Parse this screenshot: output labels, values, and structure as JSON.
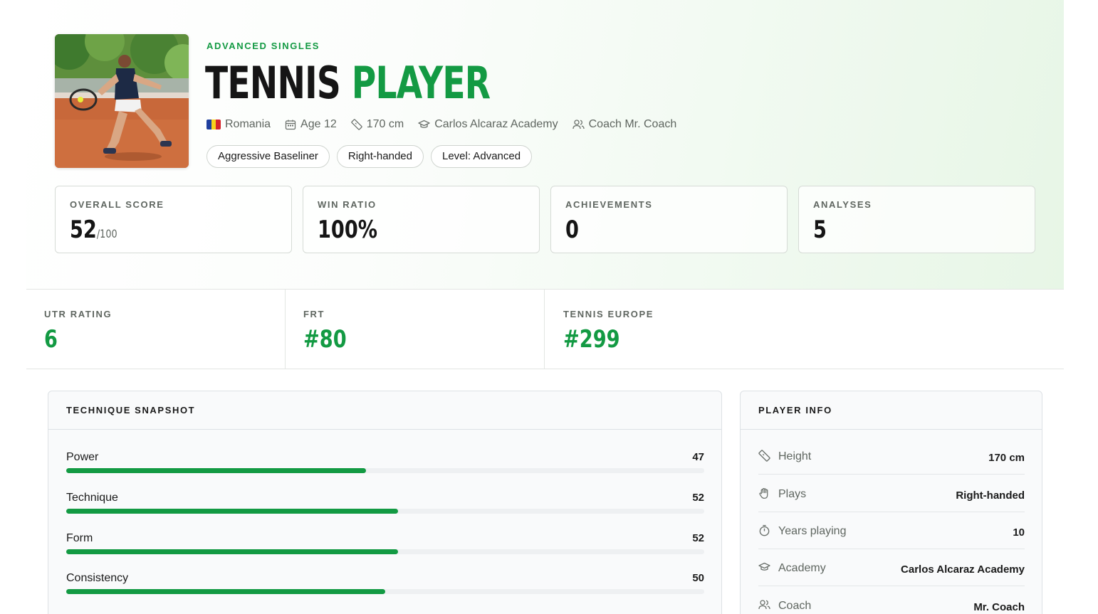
{
  "colors": {
    "accent": "#139a43",
    "text_dark": "#151515",
    "text_muted": "#5f6660",
    "track": "#eef0f2"
  },
  "hero": {
    "eyebrow": "ADVANCED SINGLES",
    "title_part1": "TENNIS",
    "title_part2": "PLAYER",
    "meta": {
      "country": "Romania",
      "age": "Age 12",
      "height": "170 cm",
      "academy": "Carlos Alcaraz Academy",
      "coach": "Coach Mr. Coach"
    },
    "chips": [
      "Aggressive Baseliner",
      "Right-handed",
      "Level: Advanced"
    ]
  },
  "stats": [
    {
      "label": "OVERALL SCORE",
      "value": "52",
      "suffix": "/100"
    },
    {
      "label": "WIN RATIO",
      "value": "100%",
      "suffix": ""
    },
    {
      "label": "ACHIEVEMENTS",
      "value": "0",
      "suffix": ""
    },
    {
      "label": "ANALYSES",
      "value": "5",
      "suffix": ""
    }
  ],
  "ratings": [
    {
      "label": "UTR RATING",
      "value": "6"
    },
    {
      "label": "FRT",
      "value": "#80"
    },
    {
      "label": "TENNIS EUROPE",
      "value": "#299"
    }
  ],
  "technique": {
    "title": "TECHNIQUE SNAPSHOT",
    "skills": [
      {
        "name": "Power",
        "value": "47",
        "fraction": 0.47
      },
      {
        "name": "Technique",
        "value": "52",
        "fraction": 0.52
      },
      {
        "name": "Form",
        "value": "52",
        "fraction": 0.52
      },
      {
        "name": "Consistency",
        "value": "50",
        "fraction": 0.5
      }
    ]
  },
  "player_info": {
    "title": "PLAYER INFO",
    "rows": [
      {
        "key": "Height",
        "value": "170 cm",
        "icon": "ruler-icon"
      },
      {
        "key": "Plays",
        "value": "Right-handed",
        "icon": "hand-icon"
      },
      {
        "key": "Years playing",
        "value": "10",
        "icon": "stopwatch-icon"
      },
      {
        "key": "Academy",
        "value": "Carlos Alcaraz Academy",
        "icon": "graduation-cap-icon"
      },
      {
        "key": "Coach",
        "value": "Mr. Coach",
        "icon": "users-icon"
      }
    ]
  }
}
